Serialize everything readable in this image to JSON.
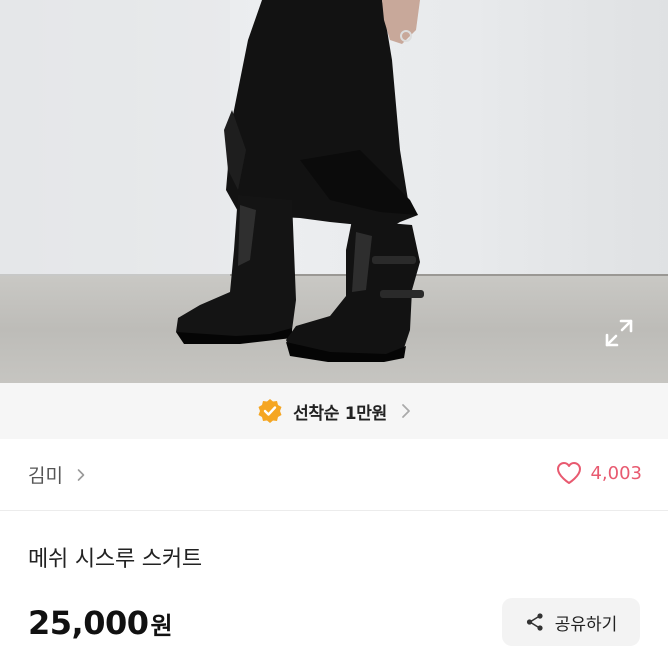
{
  "photo": {
    "alt": "product-photo",
    "expand_icon": "expand-icon"
  },
  "promo": {
    "icon": "verified-badge-icon",
    "text": "선착순 1만원",
    "accent": "#f5a623"
  },
  "seller": {
    "name": "김미",
    "icon": "chevron-right-icon"
  },
  "likes": {
    "icon": "heart-icon",
    "count": "4,003",
    "color": "#e85a70"
  },
  "product": {
    "title": "메쉬 시스루 스커트",
    "price": "25,000",
    "currency": "원"
  },
  "share": {
    "icon": "share-icon",
    "label": "공유하기"
  }
}
